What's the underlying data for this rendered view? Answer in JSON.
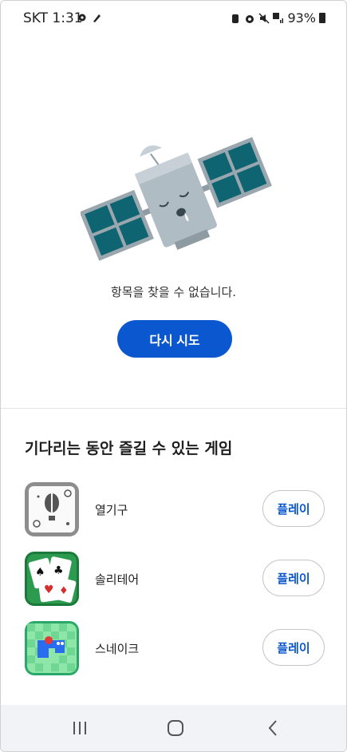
{
  "status_bar": {
    "time": "SKT 1:31",
    "battery": "93%"
  },
  "error": {
    "message": "항목을 찾을 수 없습니다.",
    "retry_label": "다시 시도"
  },
  "games": {
    "title": "기다리는 동안 즐길 수 있는 게임",
    "play_label": "플레이",
    "items": [
      {
        "name": "열기구",
        "icon": "hot-air-balloon-icon"
      },
      {
        "name": "솔리테어",
        "icon": "solitaire-cards-icon"
      },
      {
        "name": "스네이크",
        "icon": "snake-game-icon"
      }
    ]
  },
  "colors": {
    "accent": "#0b57d0",
    "satellite_panel": "#0e6470",
    "satellite_body": "#b0bcc4"
  }
}
